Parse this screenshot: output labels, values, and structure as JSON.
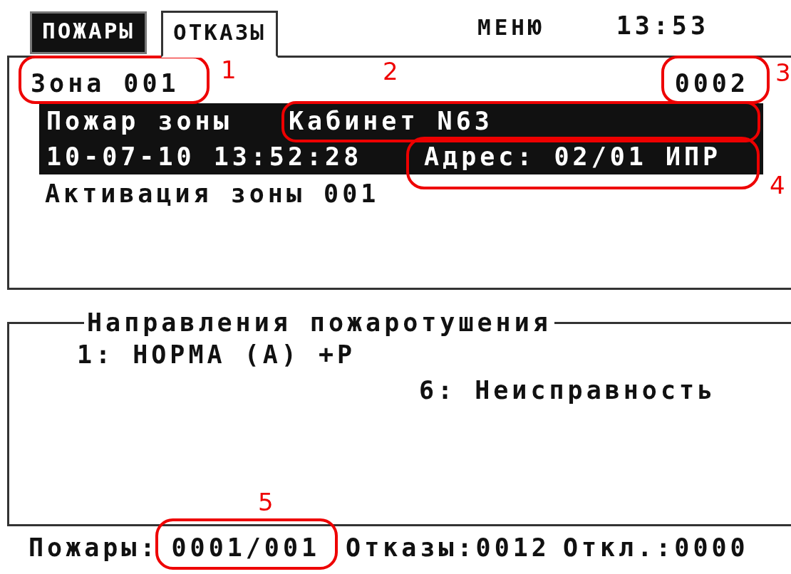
{
  "tabs": [
    {
      "label": "ПОЖАРЫ",
      "selected": false,
      "highlighted": true
    },
    {
      "label": "ОТКАЗЫ",
      "selected": true,
      "highlighted": false
    }
  ],
  "menu": "МЕНЮ",
  "clock": "13:53",
  "event": {
    "zone": "Зона 001",
    "counter": "0002",
    "type": "Пожар зоны",
    "place": "Кабинет N63",
    "datetime": "10-07-10 13:52:28",
    "address": "Адрес: 02/01 ИПР",
    "description": "Активация зоны 001"
  },
  "directions": {
    "title": "Направления пожаротушения",
    "items": [
      {
        "text": "1: НОРМА (А) +Р"
      },
      {
        "text": "6: Неисправность"
      }
    ]
  },
  "status_bar": {
    "fires_label": "Пожары:",
    "fires_value": "0001/001",
    "faults": "Отказы:0012",
    "disabled": "Откл.:0000"
  },
  "annotations": [
    {
      "label": "1"
    },
    {
      "label": "2"
    },
    {
      "label": "3"
    },
    {
      "label": "4"
    },
    {
      "label": "5"
    }
  ]
}
